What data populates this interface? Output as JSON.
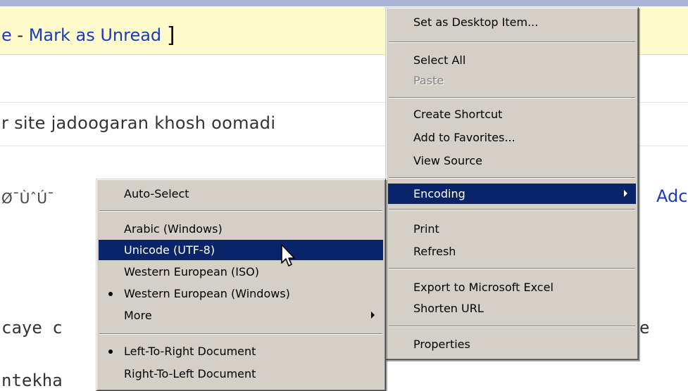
{
  "page": {
    "banner": {
      "prefix": "e",
      "dash": " - ",
      "link": "Mark as Unread",
      "bracket": "]"
    },
    "line1": "r site jadoogaran khosh oomadi",
    "line2": "ØˉÙˆÚˉ",
    "line3_mark": "",
    "line3_link": "Adc",
    "line4": "caye c",
    "line5": "ntekha",
    "line6": "e"
  },
  "context_menu": {
    "items": [
      {
        "label": "Set as Desktop Item..."
      },
      {
        "label": "Select All"
      },
      {
        "label": "Paste",
        "disabled": true
      },
      {
        "label": "Create Shortcut"
      },
      {
        "label": "Add to Favorites..."
      },
      {
        "label": "View Source"
      },
      {
        "label": "Encoding",
        "selected": true,
        "submenu": true
      },
      {
        "label": "Print"
      },
      {
        "label": "Refresh"
      },
      {
        "label": "Export to Microsoft Excel"
      },
      {
        "label": "Shorten URL"
      },
      {
        "label": "Properties"
      }
    ]
  },
  "encoding_menu": {
    "items": [
      {
        "label": "Auto-Select"
      },
      {
        "label": "Arabic (Windows)"
      },
      {
        "label": "Unicode (UTF-8)",
        "selected": true
      },
      {
        "label": "Western European (ISO)"
      },
      {
        "label": "Western European (Windows)",
        "checked": true
      },
      {
        "label": "More",
        "submenu": true
      },
      {
        "label": "Left-To-Right Document",
        "checked": true
      },
      {
        "label": "Right-To-Left Document"
      }
    ]
  },
  "colors": {
    "menu_bg": "#d4d0c8",
    "highlight": "#0a246a",
    "link": "#1a3bbf",
    "banner_bg": "#fffbcc"
  },
  "cursor": {
    "icon": "arrow-pointer-icon"
  }
}
